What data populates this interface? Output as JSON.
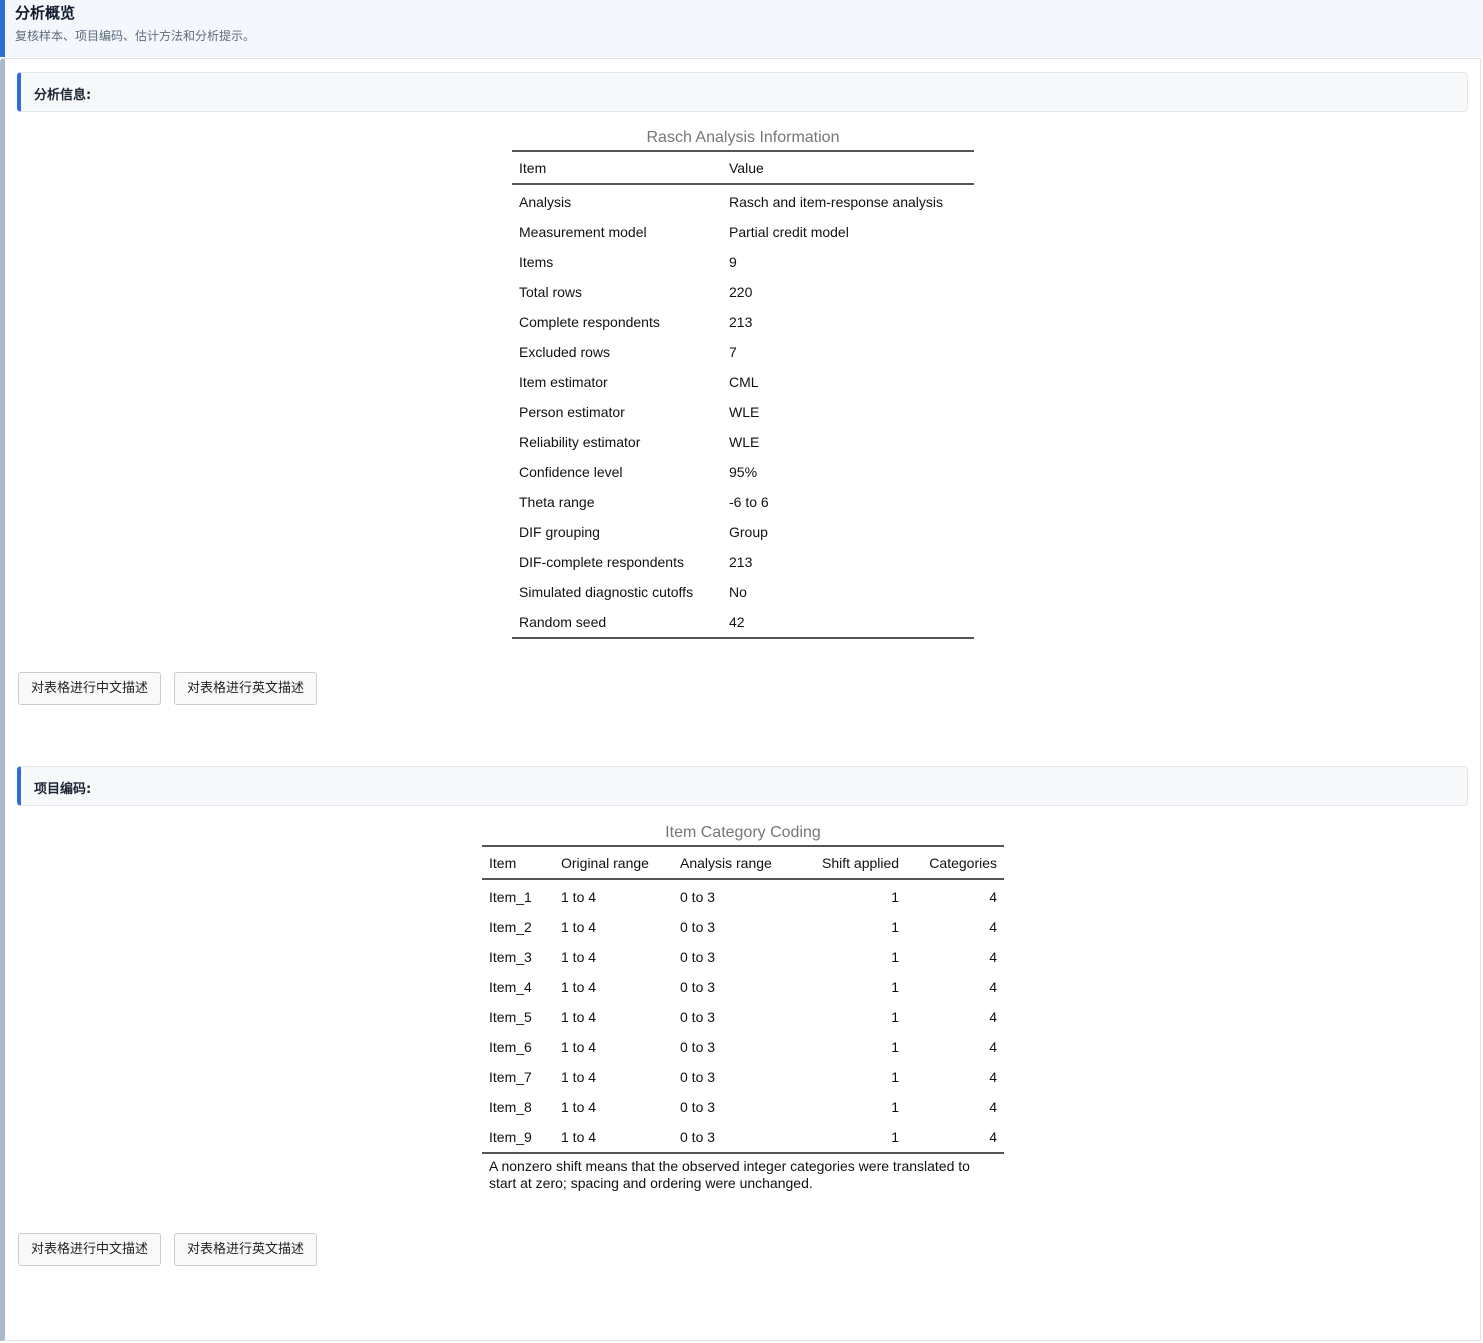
{
  "header": {
    "title": "分析概览",
    "subtitle": "复核样本、项目编码、估计方法和分析提示。"
  },
  "sections": {
    "info": {
      "label": "分析信息:",
      "table": {
        "caption": "Rasch Analysis Information",
        "columns": [
          "Item",
          "Value"
        ],
        "rows": [
          [
            "Analysis",
            "Rasch and item-response analysis"
          ],
          [
            "Measurement model",
            "Partial credit model"
          ],
          [
            "Items",
            "9"
          ],
          [
            "Total rows",
            "220"
          ],
          [
            "Complete respondents",
            "213"
          ],
          [
            "Excluded rows",
            "7"
          ],
          [
            "Item estimator",
            "CML"
          ],
          [
            "Person estimator",
            "WLE"
          ],
          [
            "Reliability estimator",
            "WLE"
          ],
          [
            "Confidence level",
            "95%"
          ],
          [
            "Theta range",
            "-6 to 6"
          ],
          [
            "DIF grouping",
            "Group"
          ],
          [
            "DIF-complete respondents",
            "213"
          ],
          [
            "Simulated diagnostic cutoffs",
            "No"
          ],
          [
            "Random seed",
            "42"
          ]
        ]
      },
      "buttons": {
        "describe_zh": "对表格进行中文描述",
        "describe_en": "对表格进行英文描述"
      }
    },
    "coding": {
      "label": "项目编码:",
      "table": {
        "caption": "Item Category Coding",
        "columns": [
          "Item",
          "Original range",
          "Analysis range",
          "Shift applied",
          "Categories"
        ],
        "rows": [
          [
            "Item_1",
            "1 to 4",
            "0 to 3",
            "1",
            "4"
          ],
          [
            "Item_2",
            "1 to 4",
            "0 to 3",
            "1",
            "4"
          ],
          [
            "Item_3",
            "1 to 4",
            "0 to 3",
            "1",
            "4"
          ],
          [
            "Item_4",
            "1 to 4",
            "0 to 3",
            "1",
            "4"
          ],
          [
            "Item_5",
            "1 to 4",
            "0 to 3",
            "1",
            "4"
          ],
          [
            "Item_6",
            "1 to 4",
            "0 to 3",
            "1",
            "4"
          ],
          [
            "Item_7",
            "1 to 4",
            "0 to 3",
            "1",
            "4"
          ],
          [
            "Item_8",
            "1 to 4",
            "0 to 3",
            "1",
            "4"
          ],
          [
            "Item_9",
            "1 to 4",
            "0 to 3",
            "1",
            "4"
          ]
        ],
        "note": "A nonzero shift means that the observed integer categories were translated to start at zero; spacing and ordering were unchanged."
      },
      "buttons": {
        "describe_zh": "对表格进行中文描述",
        "describe_en": "对表格进行英文描述"
      }
    }
  }
}
